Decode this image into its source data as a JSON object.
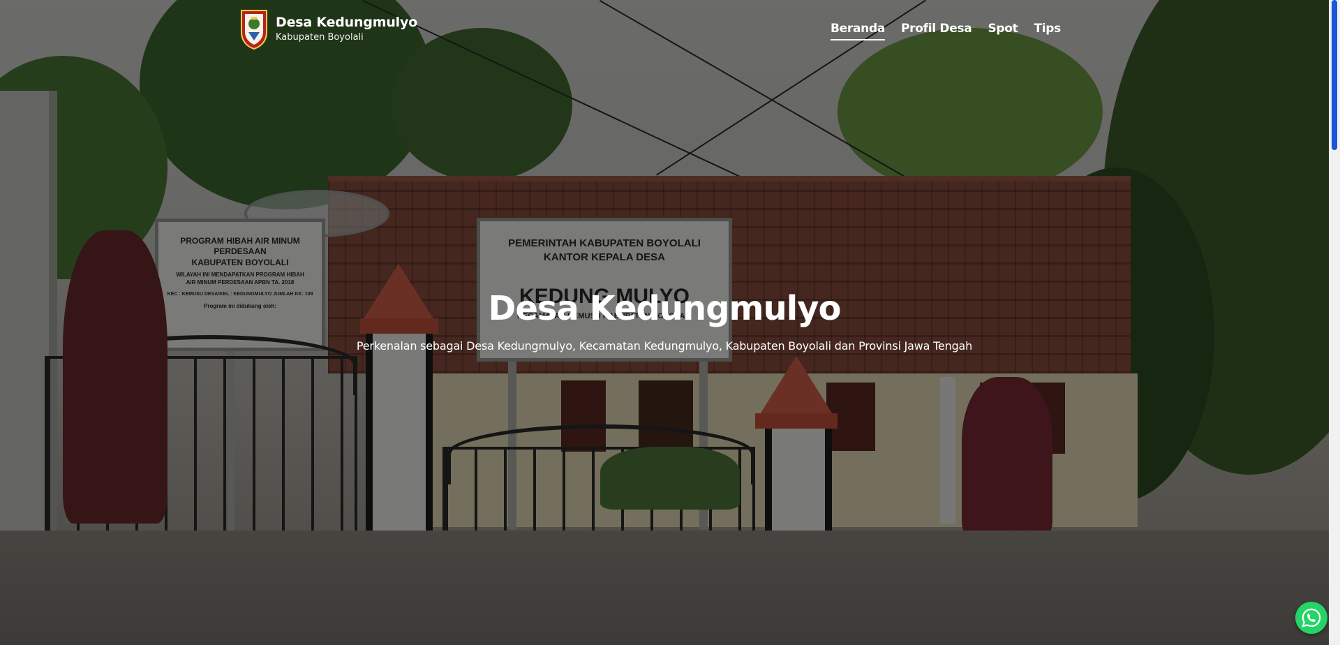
{
  "header": {
    "brand_title": "Desa Kedungmulyo",
    "brand_subtitle": "Kabupaten Boyolali",
    "logo_icon": "boyolali-regency-crest-icon"
  },
  "nav": {
    "items": [
      {
        "label": "Beranda",
        "active": true
      },
      {
        "label": "Profil Desa",
        "active": false
      },
      {
        "label": "Spot",
        "active": false
      },
      {
        "label": "Tips",
        "active": false
      }
    ]
  },
  "hero": {
    "title": "Desa Kedungmulyo",
    "subtitle": "Perkenalan sebagai Desa Kedungmulyo, Kecamatan Kedungmulyo, Kabupaten Boyolali dan Provinsi Jawa Tengah"
  },
  "photo": {
    "sign_left": {
      "line1": "PROGRAM HIBAH AIR MINUM PERDESAAN",
      "line2": "KABUPATEN BOYOLALI",
      "line3": "WILAYAH INI MENDAPATKAN PROGRAM HIBAH",
      "line4": "AIR MINUM PERDESAAN APBN TA. 2018",
      "line5": "KEC : KEMUSU DESA/KEL : KEDUNGMULYO JUMLAH KK: 109",
      "line6": "Program ini didukung oleh:"
    },
    "sign_center": {
      "line1": "PEMERINTAH KABUPATEN BOYOLALI",
      "line2": "KANTOR KEPALA DESA",
      "line3": "KEDUNG MULYO",
      "line4": "KECAMATAN KEMUSU KABUPATEN BOYOLALI"
    }
  },
  "floating": {
    "whatsapp_icon": "whatsapp-icon"
  },
  "colors": {
    "overlay": "#000000",
    "text": "#ffffff",
    "whatsapp": "#25d366",
    "scroll_thumb": "#1a56db"
  }
}
